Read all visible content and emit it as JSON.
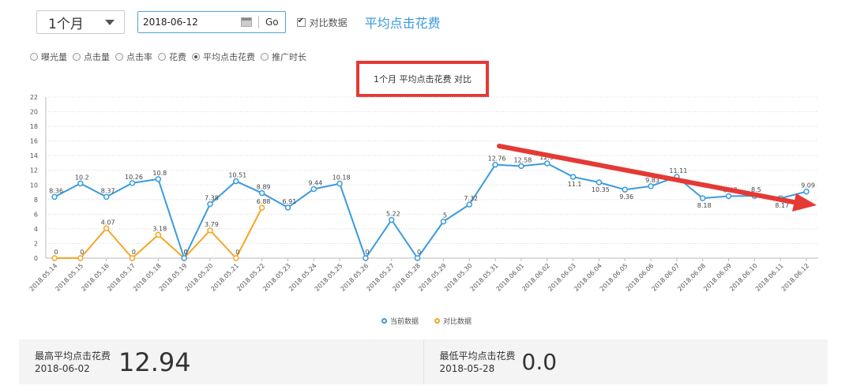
{
  "toolbar": {
    "period_value": "1个月",
    "date_value": "2018-06-12",
    "go_label": "Go",
    "compare_label": "对比数据",
    "metric_title": "平均点击花费"
  },
  "metrics": [
    {
      "label": "曝光量",
      "checked": false
    },
    {
      "label": "点击量",
      "checked": false
    },
    {
      "label": "点击率",
      "checked": false
    },
    {
      "label": "花费",
      "checked": false
    },
    {
      "label": "平均点击花费",
      "checked": true
    },
    {
      "label": "推广时长",
      "checked": false
    }
  ],
  "chart_title": "1个月  平均点击花费  对比",
  "chart_data": {
    "type": "line",
    "title": "1个月  平均点击花费  对比",
    "ylim": [
      0,
      22
    ],
    "yticks": [
      0,
      2,
      4,
      6,
      8,
      10,
      12,
      14,
      16,
      18,
      20,
      22
    ],
    "x": [
      "2018.05.14",
      "2018.05.15",
      "2018.05.16",
      "2018.05.17",
      "2018.05.18",
      "2018.05.19",
      "2018.05.20",
      "2018.05.21",
      "2018.05.22",
      "2018.05.23",
      "2018.05.24",
      "2018.05.25",
      "2018.05.26",
      "2018.05.27",
      "2018.05.28",
      "2018.05.29",
      "2018.05.30",
      "2018.05.31",
      "2018.06.01",
      "2018.06.02",
      "2018.06.03",
      "2018.06.04",
      "2018.06.05",
      "2018.06.06",
      "2018.06.07",
      "2018.06.08",
      "2018.06.09",
      "2018.06.10",
      "2018.06.11",
      "2018.06.12"
    ],
    "series": [
      {
        "name": "当前数据",
        "color": "#3a9bdc",
        "values": [
          8.36,
          10.2,
          8.37,
          10.26,
          10.8,
          0,
          7.38,
          10.51,
          8.89,
          6.91,
          9.44,
          10.18,
          0,
          5.22,
          0,
          5,
          7.32,
          12.76,
          12.58,
          12.94,
          11.1,
          10.35,
          9.36,
          9.83,
          11.11,
          8.18,
          8.47,
          8.5,
          8.17,
          9.09
        ],
        "labels": [
          "8.36",
          "10.2",
          "8.37",
          "10.26",
          "10.8",
          "0",
          "7.38",
          "10.51",
          "8.89",
          "6.91",
          "9.44",
          "10.18",
          "0",
          "5.22",
          "0",
          "5",
          "7.32",
          "12.76",
          "12.58",
          "12.94",
          "11.1",
          "10.35",
          "9.36",
          "9.83",
          "11.11",
          "8.18",
          "8.47",
          "8.5",
          "8.17",
          "9.09"
        ]
      },
      {
        "name": "对比数据",
        "color": "#f5a623",
        "values": [
          0,
          0,
          4.07,
          0,
          3.18,
          0,
          3.79,
          0,
          6.88
        ],
        "labels": [
          "0",
          "0",
          "4.07",
          "0",
          "3.18",
          "0",
          "3.79",
          "0",
          "6.88"
        ]
      }
    ]
  },
  "stats": {
    "high": {
      "label": "最高平均点击花费",
      "date": "2018-06-02",
      "value": "12.94"
    },
    "low": {
      "label": "最低平均点击花费",
      "date": "2018-05-28",
      "value": "0.0"
    }
  },
  "colors": {
    "accent": "#3a9bdc",
    "compare": "#f5a623",
    "highlight_box": "#e53935",
    "trend_arrow": "#e53935"
  }
}
